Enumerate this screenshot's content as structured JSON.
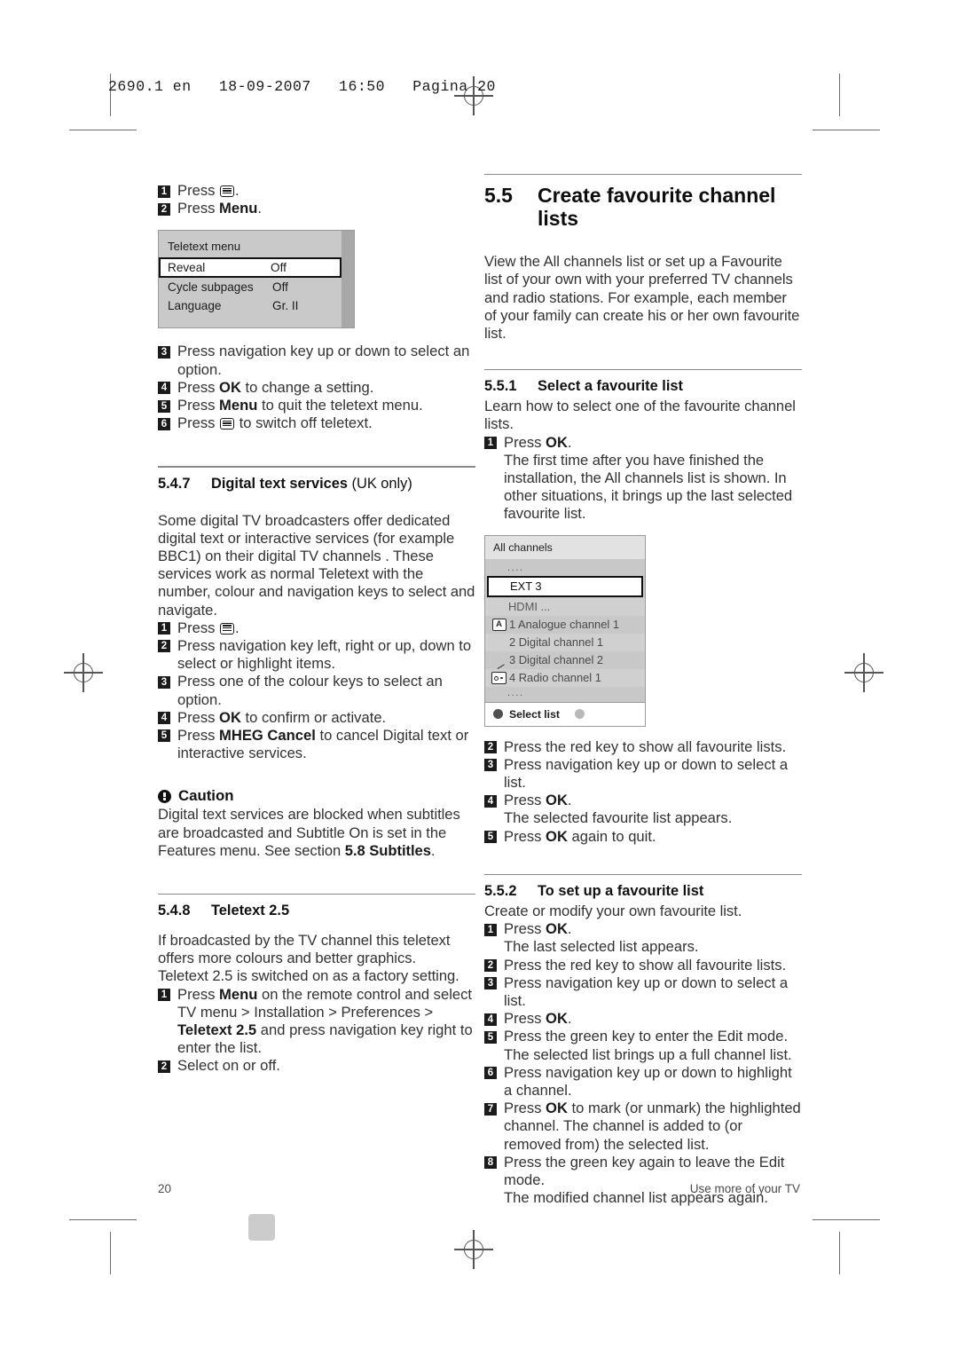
{
  "page_header": "2690.1 en   18-09-2007   16:50   Pagina 20",
  "footer": {
    "page_number": "20",
    "section_label": "Use more of your TV"
  },
  "left_column": {
    "steps_top": [
      {
        "num": "1",
        "pre": "Press ",
        "icon": "teletext-icon",
        "post": "."
      },
      {
        "num": "2",
        "pre": "Press ",
        "bold": "Menu",
        "post": "."
      }
    ],
    "teletext_menu": {
      "title": "Teletext menu",
      "rows": [
        {
          "label": "Reveal",
          "value": "Off",
          "selected": true
        },
        {
          "label": "Cycle subpages",
          "value": "Off",
          "selected": false
        },
        {
          "label": "Language",
          "value": "Gr. II",
          "selected": false
        }
      ]
    },
    "steps_mid": [
      {
        "num": "3",
        "text": "Press navigation key up or down to select an option."
      },
      {
        "num": "4",
        "pre": "Press ",
        "bold": "OK",
        "post": " to change a setting."
      },
      {
        "num": "5",
        "pre": "Press ",
        "bold": "Menu",
        "post": " to quit the teletext menu."
      },
      {
        "num": "6",
        "pre": "Press ",
        "icon": "teletext-icon",
        "post": " to switch off teletext."
      }
    ],
    "section_547": {
      "number": "5.4.7",
      "title": "Digital text services",
      "title_note": " (UK only)",
      "body": "Some digital TV broadcasters offer dedicated digital text or interactive services (for example BBC1) on their digital TV channels . These services work as normal Teletext with the number, colour and navigation keys to select and navigate.",
      "steps": [
        {
          "num": "1",
          "pre": "Press ",
          "icon": "teletext-icon",
          "post": "."
        },
        {
          "num": "2",
          "text": "Press navigation key left, right or up, down to select or highlight items."
        },
        {
          "num": "3",
          "text": "Press one of the colour keys to select an option."
        },
        {
          "num": "4",
          "pre": "Press ",
          "bold": "OK",
          "post": " to confirm or activate."
        },
        {
          "num": "5",
          "pre": "Press ",
          "bold": "MHEG Cancel",
          "post": " to cancel Digital text or interactive services."
        }
      ]
    },
    "caution": {
      "title": "Caution",
      "body_pre": "Digital text services are blocked when subtitles are broadcasted and Subtitle On is set in the Features menu. See section ",
      "body_bold": "5.8 Subtitles",
      "body_post": "."
    },
    "section_548": {
      "number": "5.4.8",
      "title": "Teletext 2.5",
      "body1": "If broadcasted by the TV channel this teletext offers more colours and better graphics.",
      "body2": "Teletext 2.5 is switched on as a factory setting.",
      "step1": {
        "num": "1",
        "p1": "Press ",
        "b1": "Menu",
        "p2": " on the remote control and select TV menu >  Installation > Preferences > ",
        "b2": "Teletext 2.5",
        "p3": " and press navigation key right to enter the list."
      },
      "step2": {
        "num": "2",
        "text": "Select on or off."
      }
    }
  },
  "right_column": {
    "section_55": {
      "number": "5.5",
      "title": "Create favourite channel lists",
      "body": "View the All channels list or set up a Favourite list of your own with your preferred TV channels and radio stations. For example, each member of your family can create his or her own favourite list."
    },
    "section_551": {
      "number": "5.5.1",
      "title": "Select a favourite list",
      "body": "Learn how to select one of the favourite channel lists.",
      "step1": {
        "num": "1",
        "pre": "Press ",
        "bold": "OK",
        "post": "."
      },
      "step1_note": "The first time after you have finished the installation, the All channels list is shown. In other situations, it brings up the last selected favourite list.",
      "channel_box": {
        "title": "All channels",
        "rows": [
          {
            "icon": "",
            "label": "....",
            "type": "dots"
          },
          {
            "icon": "",
            "label": "EXT 3",
            "type": "selected"
          },
          {
            "icon": "",
            "label": "HDMI ...",
            "type": "hdmi"
          },
          {
            "icon": "analogue-icon",
            "label": "1 Analogue channel 1",
            "type": "normal"
          },
          {
            "icon": "",
            "label": "2 Digital channel 1",
            "type": "normal"
          },
          {
            "icon": "",
            "label": "3 Digital channel 2",
            "type": "normal"
          },
          {
            "icon": "radio-icon",
            "label": "4 Radio channel 1",
            "type": "normal"
          },
          {
            "icon": "",
            "label": "....",
            "type": "dots"
          }
        ],
        "footer_label": "Select list"
      },
      "steps_after": [
        {
          "num": "2",
          "text": "Press the red key to show all favourite lists."
        },
        {
          "num": "3",
          "text": "Press navigation key up or down to select a list."
        },
        {
          "num": "4",
          "pre": "Press ",
          "bold": "OK",
          "post": "."
        },
        {
          "num": "",
          "text": "The selected favourite list appears."
        },
        {
          "num": "5",
          "pre": "Press ",
          "bold": "OK",
          "post": " again to quit."
        }
      ]
    },
    "section_552": {
      "number": "5.5.2",
      "title": "To set up a favourite list",
      "body": "Create or modify your own favourite list.",
      "steps": [
        {
          "num": "1",
          "pre": "Press ",
          "bold": "OK",
          "post": "."
        },
        {
          "num": "",
          "text": "The last selected list appears."
        },
        {
          "num": "2",
          "text": "Press the red key to show all favourite lists."
        },
        {
          "num": "3",
          "text": "Press navigation key up or down to select a list."
        },
        {
          "num": "4",
          "pre": "Press ",
          "bold": "OK",
          "post": "."
        },
        {
          "num": "5",
          "text": "Press the green key to enter the Edit mode."
        },
        {
          "num": "",
          "text": "The selected list brings up a full channel list."
        },
        {
          "num": "6",
          "text": "Press navigation key up or down to highlight a channel."
        },
        {
          "num": "7",
          "pre": "Press ",
          "bold": "OK",
          "post": " to mark (or unmark) the highlighted channel. The channel is added to (or removed from) the selected list."
        },
        {
          "num": "8",
          "text": "Press the green key again to leave the Edit mode."
        },
        {
          "num": "",
          "text": "The modified channel list appears again."
        }
      ]
    }
  }
}
